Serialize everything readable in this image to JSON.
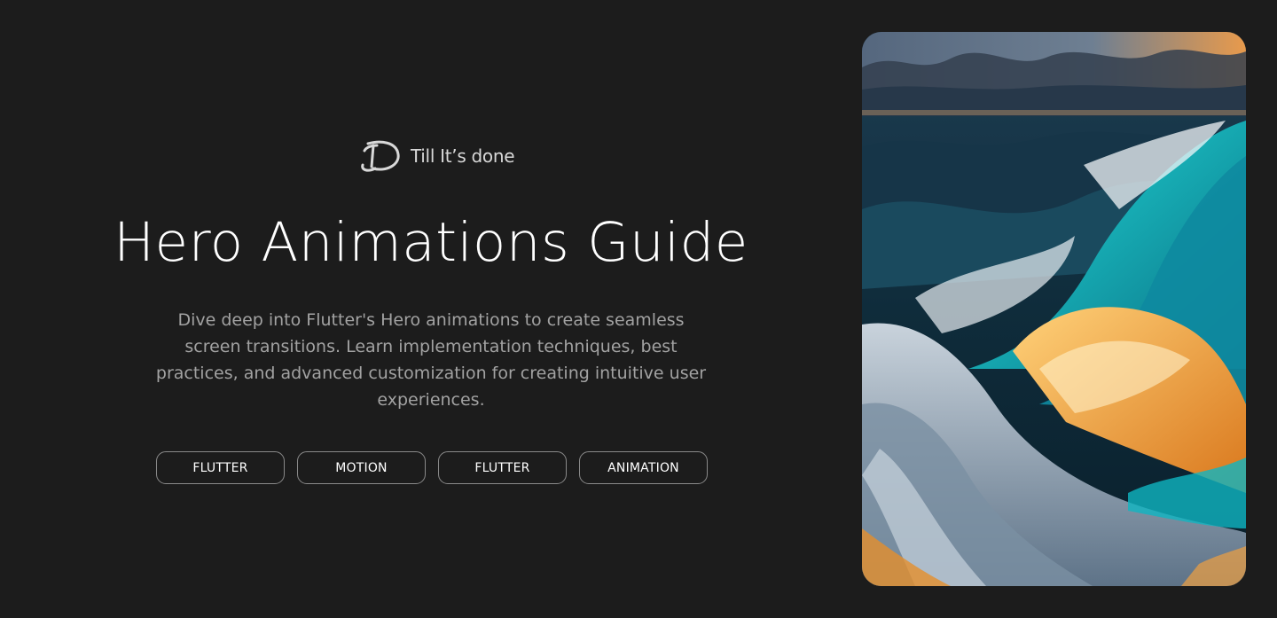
{
  "brand": {
    "logo_icon": "till-its-done-logo-icon",
    "name": "Till It’s done"
  },
  "hero": {
    "title": "Hero Animations Guide",
    "description": "Dive deep into Flutter's Hero animations to create seamless screen transitions. Learn implementation techniques, best practices, and advanced customization for creating intuitive user experiences."
  },
  "tags": [
    {
      "label": "FLUTTER"
    },
    {
      "label": "MOTION"
    },
    {
      "label": "FLUTTER"
    },
    {
      "label": "ANIMATION"
    }
  ],
  "image": {
    "subject": "stylized ocean waves at sunset artwork",
    "colors": {
      "sky": "#5c6f86",
      "sunset": "#f2a04a",
      "deep_water": "#0d2a38",
      "teal": "#19c7c9",
      "foam": "#e8eef3",
      "gold": "#f5a623"
    }
  },
  "theme": {
    "background": "#1c1c1c",
    "text_primary": "#ffffff",
    "text_secondary": "#a2a2a2",
    "tag_border": "#8a8a8a"
  }
}
